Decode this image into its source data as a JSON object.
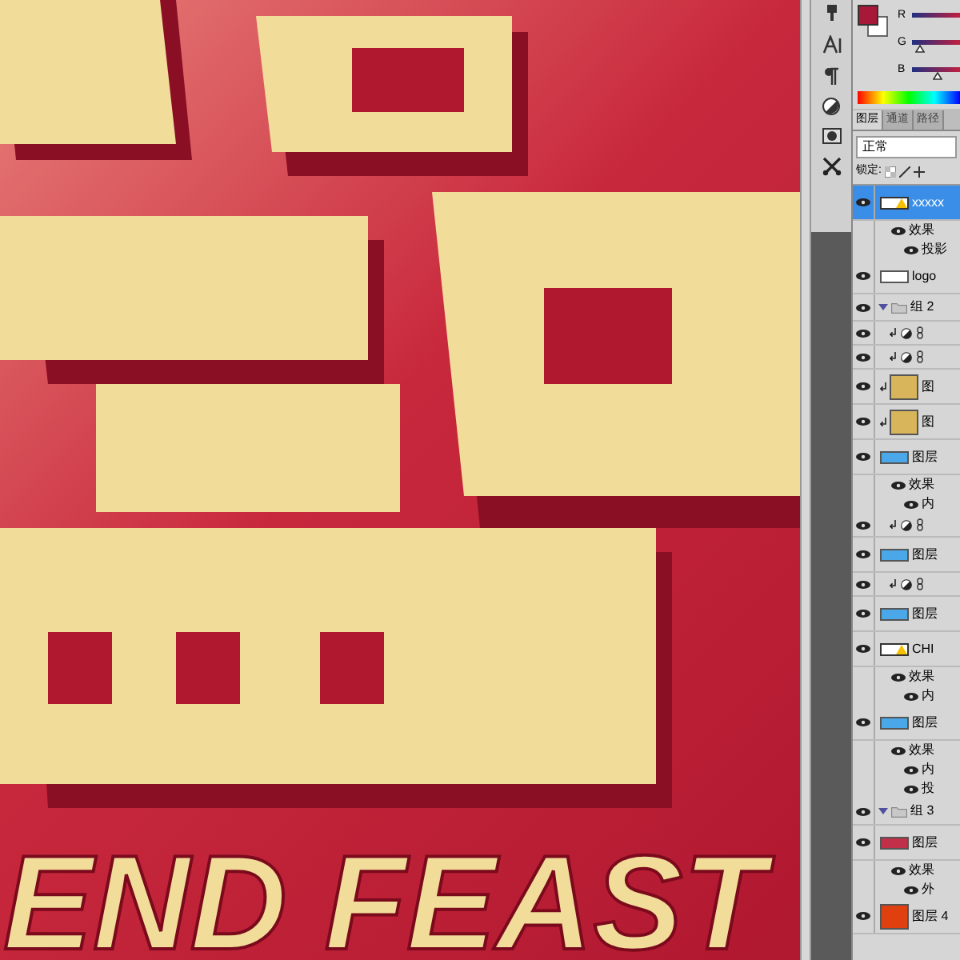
{
  "canvas": {
    "banner_text": "END FEAST"
  },
  "color_panel": {
    "channels": [
      {
        "label": "R"
      },
      {
        "label": "G",
        "level": 0.17
      },
      {
        "label": "B",
        "level": 0.52
      }
    ]
  },
  "layers_panel": {
    "tabs": [
      {
        "label": "图层",
        "selected": true
      },
      {
        "label": "通道",
        "selected": false
      },
      {
        "label": "路径",
        "selected": false
      }
    ],
    "blend_mode": "正常",
    "lock_label": "锁定:",
    "layers": [
      {
        "kind": "layer",
        "thumb": {
          "kind": "text"
        },
        "name": "xxxxx",
        "selected": true,
        "children": [
          {
            "kind": "effects",
            "name": "效果",
            "children": [
              {
                "kind": "effect",
                "name": "投影"
              }
            ]
          }
        ]
      },
      {
        "kind": "layer",
        "thumb": {
          "kind": "logo"
        },
        "name": "logo",
        "selected": false
      },
      {
        "kind": "group",
        "name": "组 2",
        "expanded": true,
        "selected": false,
        "children": [
          {
            "kind": "adjustment",
            "clipped": true,
            "selected": false
          },
          {
            "kind": "adjustment",
            "clipped": true,
            "selected": false
          },
          {
            "kind": "layer",
            "thumb": {
              "kind": "gold"
            },
            "name": "图",
            "clipped": true,
            "selected": false
          },
          {
            "kind": "layer",
            "thumb": {
              "kind": "gold"
            },
            "name": "图",
            "clipped": true,
            "selected": false
          },
          {
            "kind": "layer",
            "thumb": {
              "kind": "blue"
            },
            "name": "图层",
            "selected": false,
            "children": [
              {
                "kind": "effects",
                "name": "效果",
                "children": [
                  {
                    "kind": "effect",
                    "name": "内"
                  }
                ]
              }
            ]
          },
          {
            "kind": "adjustment",
            "clipped": true,
            "selected": false
          },
          {
            "kind": "layer",
            "thumb": {
              "kind": "blue"
            },
            "name": "图层",
            "selected": false
          },
          {
            "kind": "adjustment",
            "clipped": true,
            "selected": false
          },
          {
            "kind": "layer",
            "thumb": {
              "kind": "blue"
            },
            "name": "图层",
            "selected": false
          },
          {
            "kind": "layer",
            "thumb": {
              "kind": "text"
            },
            "name": "CHI",
            "selected": false,
            "children": [
              {
                "kind": "effects",
                "name": "效果",
                "children": [
                  {
                    "kind": "effect",
                    "name": "内"
                  }
                ]
              }
            ]
          },
          {
            "kind": "layer",
            "thumb": {
              "kind": "blue"
            },
            "name": "图层",
            "selected": false,
            "children": [
              {
                "kind": "effects",
                "name": "效果",
                "children": [
                  {
                    "kind": "effect",
                    "name": "内"
                  },
                  {
                    "kind": "effect",
                    "name": "投"
                  }
                ]
              }
            ]
          }
        ]
      },
      {
        "kind": "group",
        "name": "组 3",
        "expanded": true,
        "selected": false,
        "children": [
          {
            "kind": "layer",
            "thumb": {
              "kind": "red"
            },
            "name": "图层",
            "selected": false,
            "children": [
              {
                "kind": "effects",
                "name": "效果",
                "children": [
                  {
                    "kind": "effect",
                    "name": "外"
                  }
                ]
              }
            ]
          }
        ]
      },
      {
        "kind": "layer",
        "thumb": {
          "kind": "fire"
        },
        "name": "图层 4",
        "selected": false
      }
    ]
  }
}
